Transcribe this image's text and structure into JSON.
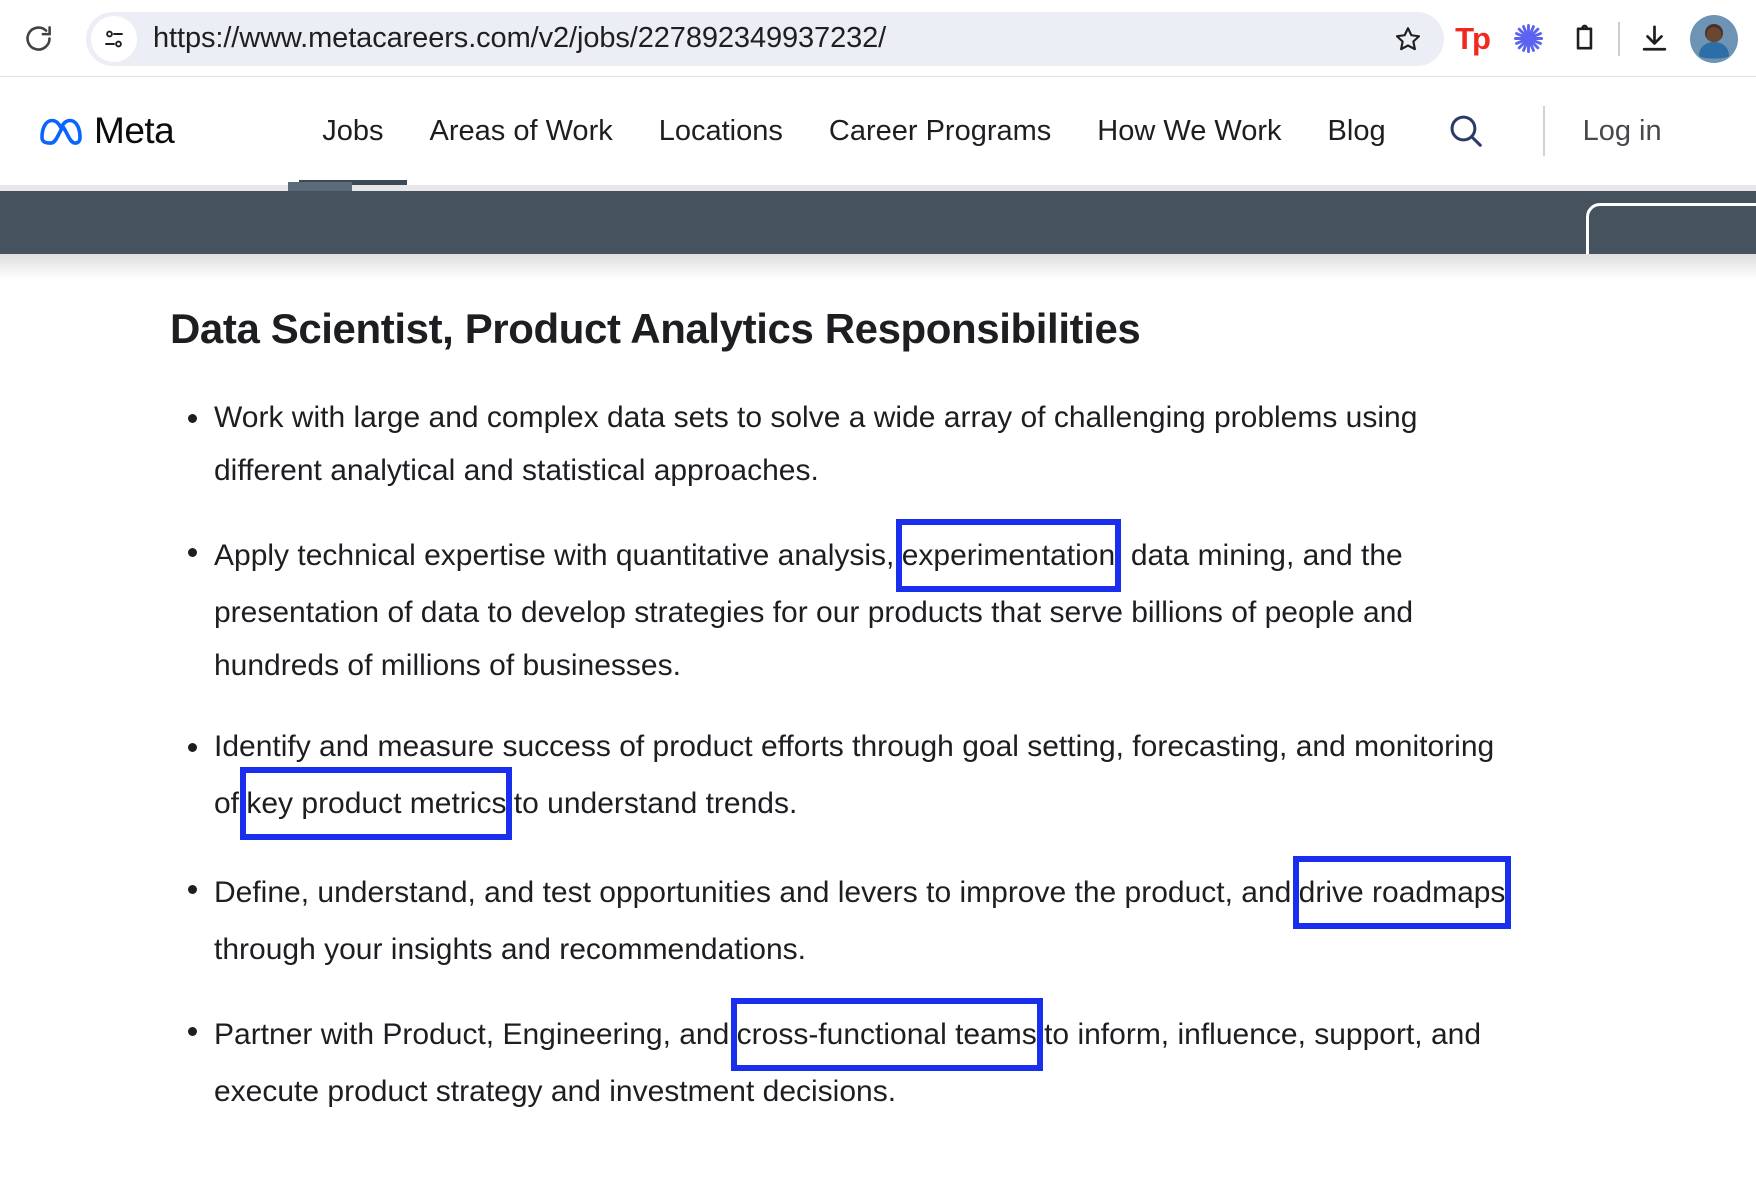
{
  "browser": {
    "reload_icon": "reload-icon",
    "page_info_icon": "page-info-icon",
    "url": "https://www.metacareers.com/v2/jobs/227892349937232/",
    "url_placeholder": "Search Google or type a URL",
    "star_icon": "bookmark-star-icon",
    "extensions": [
      {
        "name": "tp-extension-icon",
        "label": "Tp",
        "color": "#f0281e"
      },
      {
        "name": "asterisk-extension-icon",
        "label": "",
        "color": "#5b63ef"
      },
      {
        "name": "extensions-puzzle-icon",
        "label": "",
        "color": "#1f1f1f"
      }
    ],
    "download_icon": "download-icon",
    "avatar": "profile-avatar"
  },
  "site_nav": {
    "logo_text": "Meta",
    "logo_color": "#0866ff",
    "links": [
      {
        "label": "Jobs",
        "active": true
      },
      {
        "label": "Areas of Work",
        "active": false
      },
      {
        "label": "Locations",
        "active": false
      },
      {
        "label": "Career Programs",
        "active": false
      },
      {
        "label": "How We Work",
        "active": false
      },
      {
        "label": "Blog",
        "active": false
      }
    ],
    "search_icon": "search-icon",
    "search_icon_color": "#2b3a67",
    "login_label": "Log in"
  },
  "banner": {
    "background_color": "#46535f",
    "button_name": "banner-action-button"
  },
  "main": {
    "title": "Data Scientist, Product Analytics Responsibilities",
    "highlight_color": "#1a2eee",
    "bullets": [
      {
        "segments": [
          {
            "text": "Work with large and complex data sets to solve a wide array of challenging problems using different analytical and statistical approaches.",
            "highlight": false
          }
        ]
      },
      {
        "segments": [
          {
            "text": "Apply technical expertise with quantitative analysis, ",
            "highlight": false
          },
          {
            "text": "experimentation",
            "highlight": true
          },
          {
            "text": ", data mining, and the presentation of data to develop strategies for our products that serve billions of people and hundreds of millions of businesses.",
            "highlight": false
          }
        ]
      },
      {
        "segments": [
          {
            "text": "Identify and measure success of product efforts through goal setting, forecasting, and monitoring of ",
            "highlight": false
          },
          {
            "text": "key product metrics",
            "highlight": true
          },
          {
            "text": " to understand trends.",
            "highlight": false
          }
        ]
      },
      {
        "segments": [
          {
            "text": "Define, understand, and test opportunities and levers to improve the product, and ",
            "highlight": false
          },
          {
            "text": "drive roadmaps",
            "highlight": true
          },
          {
            "text": " through your insights and recommendations.",
            "highlight": false
          }
        ]
      },
      {
        "segments": [
          {
            "text": "Partner with Product, Engineering, and ",
            "highlight": false
          },
          {
            "text": "cross-functional teams",
            "highlight": true
          },
          {
            "text": " to inform, influence, support, and execute product strategy and investment decisions.",
            "highlight": false
          }
        ]
      }
    ]
  }
}
